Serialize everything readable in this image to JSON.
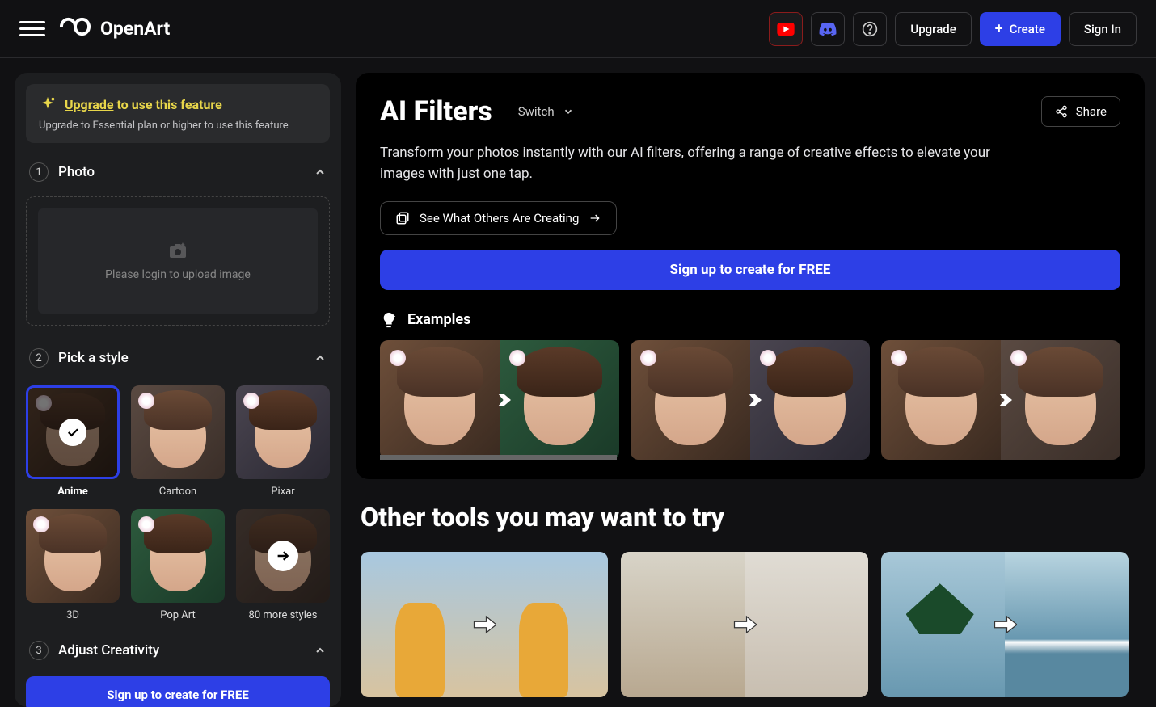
{
  "brand": "OpenArt",
  "header": {
    "upgrade": "Upgrade",
    "create": "Create",
    "signin": "Sign In"
  },
  "sidebar": {
    "upgrade": {
      "link": "Upgrade",
      "rest": " to use this feature",
      "sub": "Upgrade to Essential plan or higher to use this feature"
    },
    "step1": {
      "num": "1",
      "title": "Photo",
      "upload_text": "Please login to upload image"
    },
    "step2": {
      "num": "2",
      "title": "Pick a style"
    },
    "step3": {
      "num": "3",
      "title": "Adjust Creativity"
    },
    "styles": [
      {
        "label": "Anime",
        "selected": true
      },
      {
        "label": "Cartoon"
      },
      {
        "label": "Pixar"
      },
      {
        "label": "3D"
      },
      {
        "label": "Pop Art"
      },
      {
        "label": "80 more styles",
        "more": true
      }
    ],
    "cta": "Sign up to create for FREE"
  },
  "hero": {
    "title": "AI Filters",
    "switch": "Switch",
    "share": "Share",
    "desc": "Transform your photos instantly with our AI filters, offering a range of creative effects to elevate your images with just one tap.",
    "see_what": "See What Others Are Creating",
    "cta": "Sign up to create for FREE",
    "examples": "Examples"
  },
  "other": {
    "title": "Other tools you may want to try"
  }
}
